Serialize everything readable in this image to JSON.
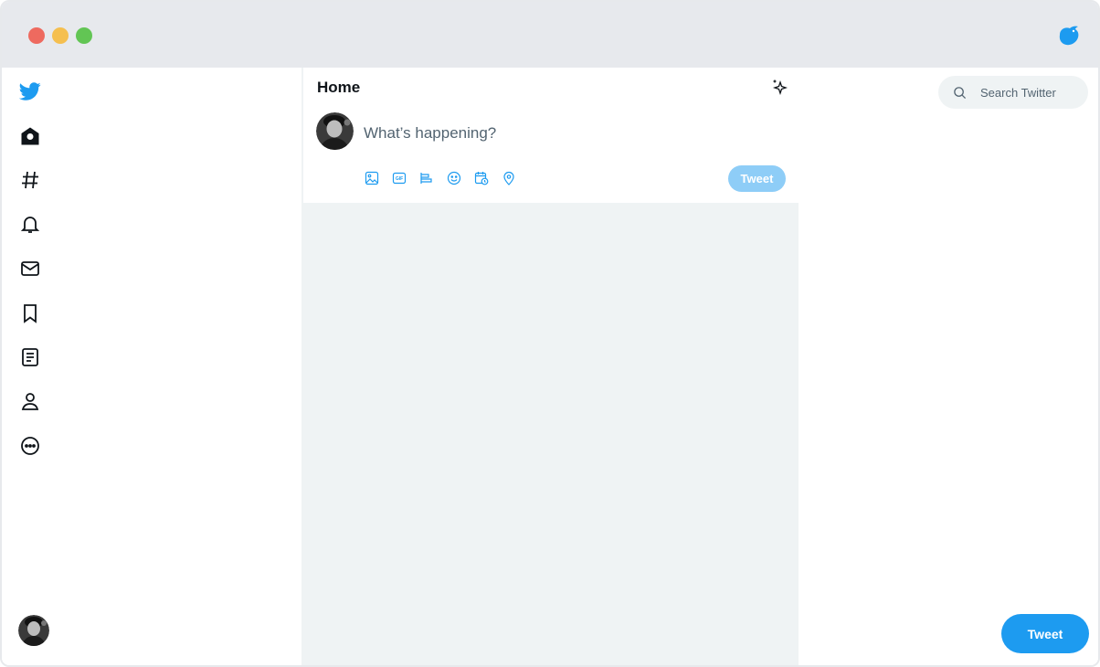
{
  "window": {
    "controls": [
      "close",
      "minimize",
      "maximize"
    ]
  },
  "colors": {
    "brand": "#1d9bf0",
    "brand_disabled": "#8ecdf7",
    "feed_bg": "#eff3f4"
  },
  "sidebar": {
    "logo_icon": "twitter-bird-icon",
    "items": [
      {
        "name": "home",
        "icon": "home-icon"
      },
      {
        "name": "explore",
        "icon": "hashtag-icon"
      },
      {
        "name": "notifications",
        "icon": "bell-icon"
      },
      {
        "name": "messages",
        "icon": "envelope-icon"
      },
      {
        "name": "bookmarks",
        "icon": "bookmark-icon"
      },
      {
        "name": "lists",
        "icon": "list-icon"
      },
      {
        "name": "profile",
        "icon": "person-icon"
      },
      {
        "name": "more",
        "icon": "more-icon"
      }
    ]
  },
  "main": {
    "title": "Home",
    "compose": {
      "placeholder": "What’s happening?",
      "tools": [
        "image-icon",
        "gif-icon",
        "poll-icon",
        "emoji-icon",
        "schedule-icon",
        "location-icon"
      ],
      "tweet_label": "Tweet"
    }
  },
  "right": {
    "search": {
      "placeholder": "Search Twitter"
    },
    "tweet_label": "Tweet"
  }
}
